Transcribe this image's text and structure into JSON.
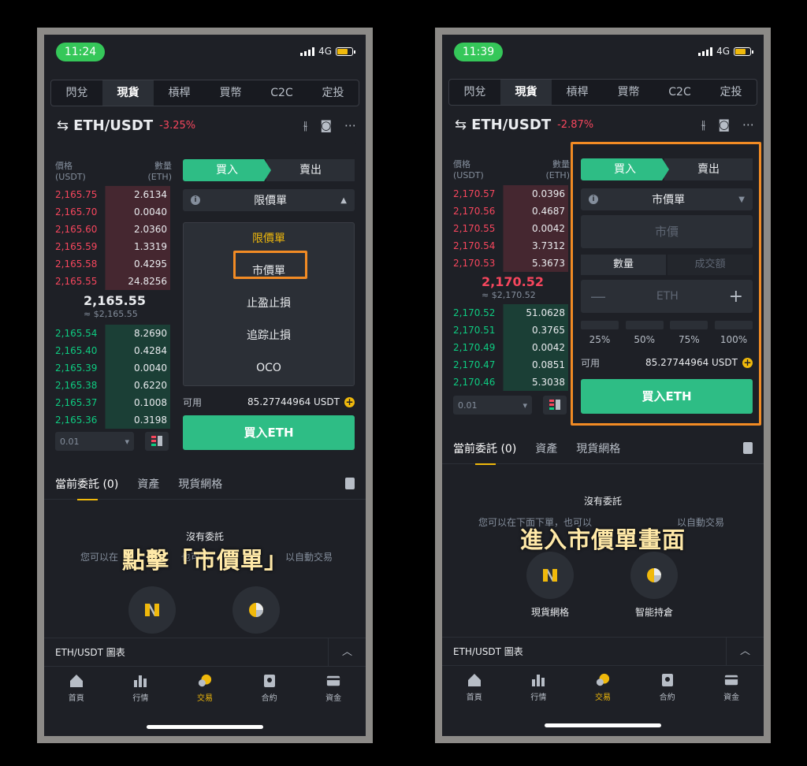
{
  "colors": {
    "buy": "#2ebd85",
    "sell": "#f6465d",
    "accent": "#f0b90b",
    "highlight": "#f28b24",
    "background": "#1e2026",
    "frame": "#8c8a87"
  },
  "left": {
    "status": {
      "time": "11:24",
      "network": "4G"
    },
    "nav": [
      "閃兌",
      "現貨",
      "槓桿",
      "買幣",
      "C2C",
      "定投"
    ],
    "nav_active": "現貨",
    "pair": {
      "name": "ETH/USDT",
      "change": "-3.25%"
    },
    "orderbook": {
      "price_header": "價格",
      "price_unit": "(USDT)",
      "qty_header": "數量",
      "qty_unit": "(ETH)",
      "asks": [
        [
          "2,165.75",
          "2.6134"
        ],
        [
          "2,165.70",
          "0.0040"
        ],
        [
          "2,165.60",
          "2.0360"
        ],
        [
          "2,165.59",
          "1.3319"
        ],
        [
          "2,165.58",
          "0.4295"
        ],
        [
          "2,165.55",
          "24.8256"
        ]
      ],
      "mid": "2,165.55",
      "mid_fiat": "≈ $2,165.55",
      "bids": [
        [
          "2,165.54",
          "8.2690"
        ],
        [
          "2,165.40",
          "0.4284"
        ],
        [
          "2,165.39",
          "0.0040"
        ],
        [
          "2,165.38",
          "0.6220"
        ],
        [
          "2,165.37",
          "0.1008"
        ],
        [
          "2,165.36",
          "0.3198"
        ]
      ],
      "depth": "0.01"
    },
    "buy_label": "買入",
    "sell_label": "賣出",
    "order_type": "限價單",
    "dropdown": [
      "限價單",
      "市價單",
      "止盈止損",
      "追踪止損",
      "OCO"
    ],
    "dropdown_selected": "限價單",
    "dropdown_highlighted": "市價單",
    "available_label": "可用",
    "available_value": "85.27744964 USDT",
    "buy_button": "買入ETH",
    "tabs": [
      "當前委託 (0)",
      "資產",
      "現貨網格"
    ],
    "empty_title": "沒有委託",
    "empty_sub_a": "您可以在",
    "empty_sub_b": "也可以",
    "empty_sub_c": "以自動交易",
    "caption": "點擊「市價單」",
    "chart_label": "ETH/USDT 圖表",
    "bottom_nav": [
      "首頁",
      "行情",
      "交易",
      "合約",
      "資金"
    ],
    "bottom_active": "交易"
  },
  "right": {
    "status": {
      "time": "11:39",
      "network": "4G"
    },
    "nav": [
      "閃兌",
      "現貨",
      "槓桿",
      "買幣",
      "C2C",
      "定投"
    ],
    "nav_active": "現貨",
    "pair": {
      "name": "ETH/USDT",
      "change": "-2.87%"
    },
    "orderbook": {
      "price_header": "價格",
      "price_unit": "(USDT)",
      "qty_header": "數量",
      "qty_unit": "(ETH)",
      "asks": [
        [
          "2,170.57",
          "0.0396"
        ],
        [
          "2,170.56",
          "0.4687"
        ],
        [
          "2,170.55",
          "0.0042"
        ],
        [
          "2,170.54",
          "3.7312"
        ],
        [
          "2,170.53",
          "5.3673"
        ]
      ],
      "mid": "2,170.52",
      "mid_fiat": "≈ $2,170.52",
      "bids": [
        [
          "2,170.52",
          "51.0628"
        ],
        [
          "2,170.51",
          "0.3765"
        ],
        [
          "2,170.49",
          "0.0042"
        ],
        [
          "2,170.47",
          "0.0851"
        ],
        [
          "2,170.46",
          "5.3038"
        ]
      ],
      "depth": "0.01"
    },
    "buy_label": "買入",
    "sell_label": "賣出",
    "order_type": "市價單",
    "price_placeholder": "市價",
    "qty_tab": "數量",
    "turnover_tab": "成交額",
    "qty_unit": "ETH",
    "pcts": [
      "25%",
      "50%",
      "75%",
      "100%"
    ],
    "available_label": "可用",
    "available_value": "85.27744964 USDT",
    "buy_button": "買入ETH",
    "tabs": [
      "當前委託 (0)",
      "資產",
      "現貨網格"
    ],
    "empty_title": "沒有委託",
    "empty_sub_a": "您可以在下面下單，也可以",
    "empty_sub_b": "以自動交易",
    "caption": "進入市價單畫面",
    "grid_label": "現貨網格",
    "smart_label": "智能持倉",
    "chart_label": "ETH/USDT 圖表",
    "bottom_nav": [
      "首頁",
      "行情",
      "交易",
      "合約",
      "資金"
    ],
    "bottom_active": "交易"
  }
}
